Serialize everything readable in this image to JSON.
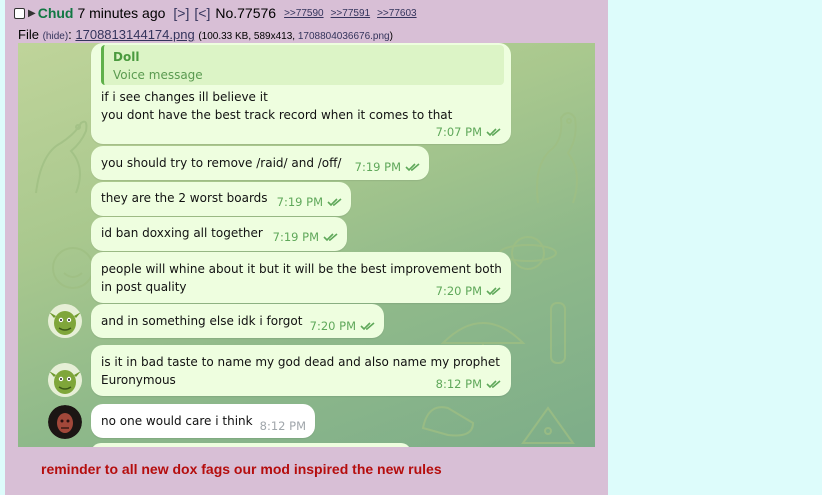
{
  "post": {
    "name": "Chud",
    "time": "7 minutes ago",
    "link_a": "[>]",
    "link_b": "[<]",
    "number": "No.77576",
    "replies": [
      ">>77590",
      ">>77591",
      ">>77603"
    ]
  },
  "file": {
    "prefix": "File",
    "hide": "(hide)",
    "filename": "1708813144174.png",
    "meta_open": "(100.33 KB, 589x413, ",
    "original": "1708804036676.png",
    "meta_close": ")"
  },
  "chat": {
    "reply_name": "Doll",
    "reply_text": "Voice message",
    "messages": [
      {
        "lines": [
          "if i see changes ill believe it",
          "you dont have the best track record when it comes to that"
        ],
        "time": "7:07 PM"
      },
      {
        "lines": [
          "you should try to remove /raid/ and /off/"
        ],
        "time": "7:19 PM"
      },
      {
        "lines": [
          "they are the 2 worst boards"
        ],
        "time": "7:19 PM"
      },
      {
        "lines": [
          "id ban doxxing all together"
        ],
        "time": "7:19 PM"
      },
      {
        "lines": [
          "people will whine about it but it will be the best improvement both",
          "in post quality"
        ],
        "time": "7:20 PM"
      },
      {
        "lines": [
          "and in something else idk i forgot"
        ],
        "time": "7:20 PM"
      },
      {
        "lines": [
          "is it in bad taste to name my god dead and also name my prophet",
          "Euronymous"
        ],
        "time": "8:12 PM"
      },
      {
        "lines": [
          "no one would care i think"
        ],
        "time": "8:12 PM"
      }
    ]
  },
  "comment": "reminder to all new dox fags our mod inspired the new rules",
  "colors": {
    "name": "#117743",
    "quote_link": "#34345c",
    "comment": "#b50d0d",
    "bubble_out": "#eefedf",
    "check": "#5fa85a"
  }
}
